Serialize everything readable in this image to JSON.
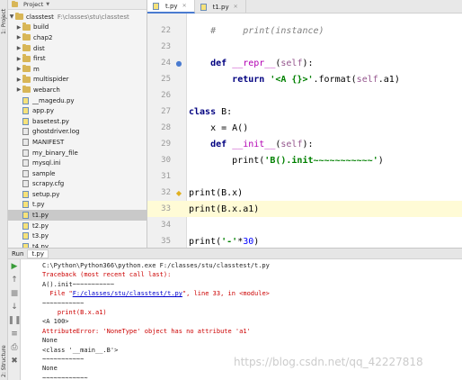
{
  "side_tabs": [
    "1: Project",
    "2: Structure"
  ],
  "project": {
    "header_label": "Project",
    "root_name": "classtest",
    "root_path": "F:\\classes\\stu\\classtest",
    "items": [
      {
        "name": "build",
        "type": "folder",
        "expandable": true
      },
      {
        "name": "chap2",
        "type": "folder",
        "expandable": true
      },
      {
        "name": "dist",
        "type": "folder",
        "expandable": true
      },
      {
        "name": "first",
        "type": "folder",
        "expandable": true
      },
      {
        "name": "m",
        "type": "folder",
        "expandable": true
      },
      {
        "name": "multispider",
        "type": "folder",
        "expandable": true
      },
      {
        "name": "webarch",
        "type": "folder",
        "expandable": true
      },
      {
        "name": "__magedu.py",
        "type": "py"
      },
      {
        "name": "app.py",
        "type": "py"
      },
      {
        "name": "basetest.py",
        "type": "py"
      },
      {
        "name": "ghostdriver.log",
        "type": "txt"
      },
      {
        "name": "MANIFEST",
        "type": "txt"
      },
      {
        "name": "my_binary_file",
        "type": "txt"
      },
      {
        "name": "mysql.ini",
        "type": "txt"
      },
      {
        "name": "sample",
        "type": "txt"
      },
      {
        "name": "scrapy.cfg",
        "type": "txt"
      },
      {
        "name": "setup.py",
        "type": "py"
      },
      {
        "name": "t.py",
        "type": "py"
      },
      {
        "name": "t1.py",
        "type": "py",
        "selected": true
      },
      {
        "name": "t2.py",
        "type": "py"
      },
      {
        "name": "t3.py",
        "type": "py"
      },
      {
        "name": "t4.py",
        "type": "py"
      }
    ]
  },
  "tabs": [
    {
      "label": "t.py",
      "active": true
    },
    {
      "label": "t1.py",
      "active": false
    }
  ],
  "editor": {
    "line_numbers": [
      "22",
      "23",
      "24",
      "25",
      "26",
      "27",
      "28",
      "29",
      "30",
      "31",
      "32",
      "33",
      "34",
      "35",
      "36",
      "37",
      "38",
      "39"
    ],
    "current_line": "33"
  },
  "run": {
    "header_label": "Run",
    "tab_label": "t.py",
    "output": [
      {
        "text": "C:\\Python\\Python366\\python.exe F:/classes/stu/classtest/t.py",
        "kind": "normal"
      },
      {
        "text": "Traceback (most recent call last):",
        "kind": "err"
      },
      {
        "text": "A().init~~~~~~~~~~~",
        "kind": "normal"
      },
      {
        "text": "  File \"",
        "link": "F:/classes/stu/classtest/t.py",
        "tail": "\", line 33, in <module>",
        "kind": "err"
      },
      {
        "text": "~~~~~~~~~~~",
        "kind": "normal"
      },
      {
        "text": "    print(B.x.a1)",
        "kind": "err"
      },
      {
        "text": "<A 100>",
        "kind": "normal"
      },
      {
        "text": "AttributeError: 'NoneType' object has no attribute 'a1'",
        "kind": "err"
      },
      {
        "text": "None",
        "kind": "normal"
      },
      {
        "text": "<class '__main__.B'>",
        "kind": "normal"
      },
      {
        "text": "~~~~~~~~~~~",
        "kind": "normal"
      },
      {
        "text": "None",
        "kind": "normal"
      },
      {
        "text": "~~~~~~~~~~~~",
        "kind": "normal"
      }
    ]
  },
  "watermark": "https://blog.csdn.net/qq_42227818"
}
